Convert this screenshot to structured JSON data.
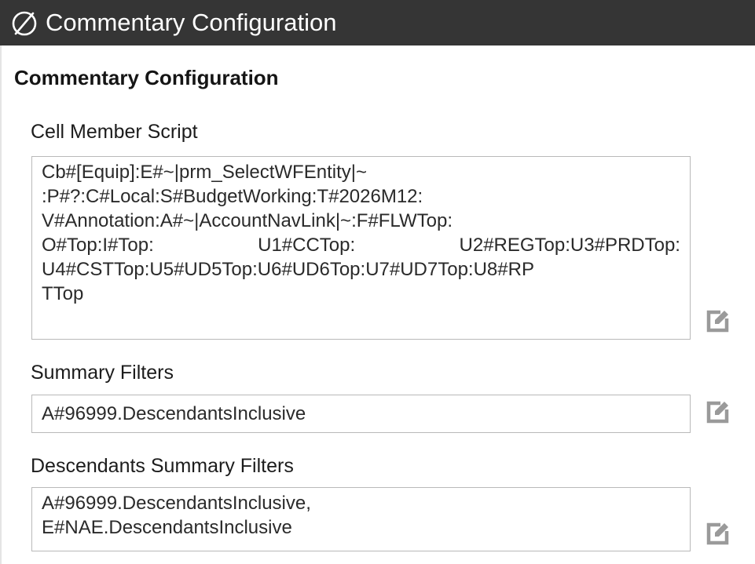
{
  "window": {
    "title": "Commentary Configuration"
  },
  "section": {
    "title": "Commentary Configuration"
  },
  "fields": {
    "cell_member_script": {
      "label": "Cell Member Script",
      "lines": [
        "Cb#[Equip]:E#~|prm_SelectWFEntity|~",
        ":P#?:C#Local:S#BudgetWorking:T#2026M12:",
        "V#Annotation:A#~|AccountNavLink|~:F#FLWTop:",
        [
          "O#Top:I#Top:",
          "U1#CCTop:",
          "U2#REGTop:U3#PRDTop:"
        ],
        "U4#CSTTop:U5#UD5Top:U6#UD6Top:U7#UD7Top:U8#RP",
        "TTop"
      ]
    },
    "summary_filters": {
      "label": "Summary Filters",
      "value": "A#96999.DescendantsInclusive"
    },
    "descendants_summary_filters": {
      "label": "Descendants Summary Filters",
      "lines": [
        "A#96999.DescendantsInclusive,",
        "E#NAE.DescendantsInclusive"
      ]
    }
  },
  "icons": {
    "app_logo": "onestream-logo-icon",
    "edit": "edit-icon"
  },
  "colors": {
    "title_bar": "#353535",
    "edit_icon": "#9a9a9a",
    "field_border": "#b9b9b9"
  }
}
